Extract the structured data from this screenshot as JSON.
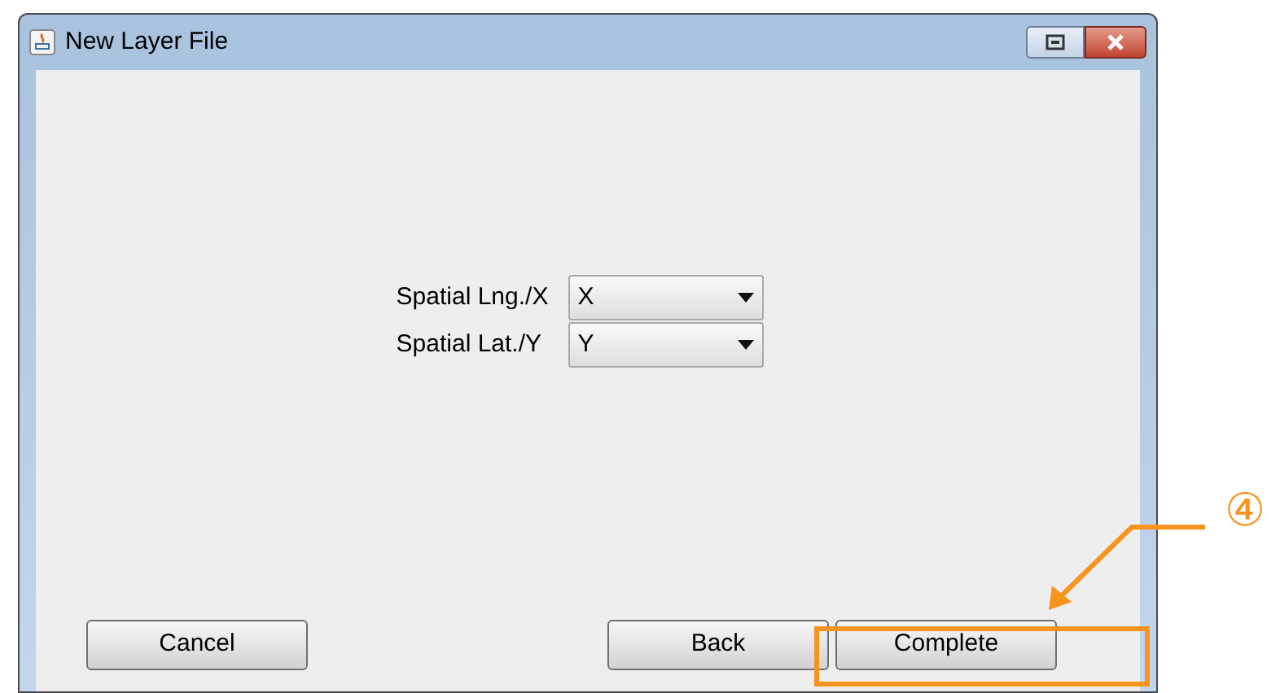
{
  "window": {
    "title": "New Layer File"
  },
  "fields": [
    {
      "label": "Spatial Lng./X",
      "value": "X"
    },
    {
      "label": "Spatial Lat./Y",
      "value": "Y"
    }
  ],
  "buttons": {
    "left": [
      "Cancel"
    ],
    "right": [
      "Back",
      "Complete"
    ]
  },
  "annotation": {
    "marker": "④"
  }
}
